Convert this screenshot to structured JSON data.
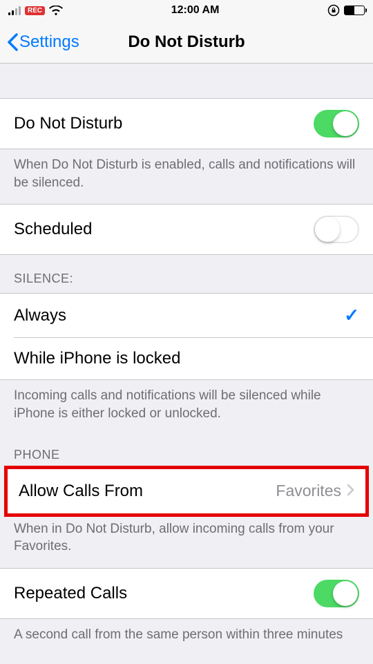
{
  "status": {
    "time": "12:00 AM",
    "rec": "REC"
  },
  "nav": {
    "back": "Settings",
    "title": "Do Not Disturb"
  },
  "dnd": {
    "label": "Do Not Disturb",
    "footer": "When Do Not Disturb is enabled, calls and notifications will be silenced."
  },
  "scheduled": {
    "label": "Scheduled"
  },
  "silence": {
    "header": "SILENCE:",
    "always": "Always",
    "locked": "While iPhone is locked",
    "footer": "Incoming calls and notifications will be silenced while iPhone is either locked or unlocked."
  },
  "phone": {
    "header": "PHONE",
    "allow_label": "Allow Calls From",
    "allow_value": "Favorites",
    "allow_footer": "When in Do Not Disturb, allow incoming calls from your Favorites."
  },
  "repeated": {
    "label": "Repeated Calls",
    "footer": "A second call from the same person within three minutes"
  }
}
